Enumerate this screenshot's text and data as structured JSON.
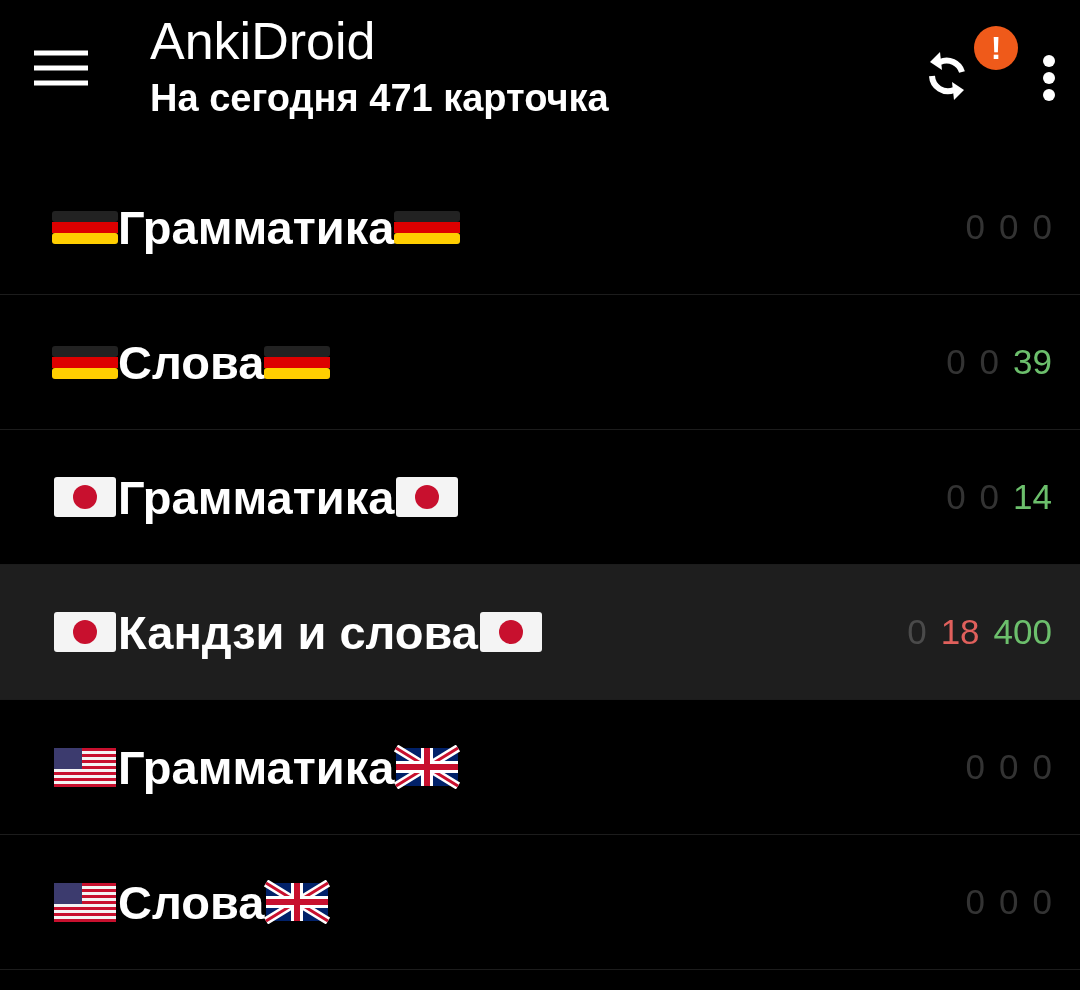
{
  "app_bar": {
    "title": "AnkiDroid",
    "subtitle": "На сегодня 471 карточка",
    "sync_badge": "!"
  },
  "decks": [
    {
      "name": "Грамматика",
      "lead_flag": {
        "kind": "de"
      },
      "trail_flag": {
        "kind": "de"
      },
      "selected": false,
      "counts": [
        {
          "text": "0",
          "color": "#333333"
        },
        {
          "text": "0",
          "color": "#333333"
        },
        {
          "text": "0",
          "color": "#333333"
        }
      ]
    },
    {
      "name": "Слова",
      "lead_flag": {
        "kind": "de"
      },
      "trail_flag": {
        "kind": "de"
      },
      "selected": false,
      "counts": [
        {
          "text": "0",
          "color": "#333333"
        },
        {
          "text": "0",
          "color": "#333333"
        },
        {
          "text": "39",
          "color": "#6cbf6c"
        }
      ]
    },
    {
      "name": "Грамматика",
      "lead_flag": {
        "kind": "jp"
      },
      "trail_flag": {
        "kind": "jp"
      },
      "selected": false,
      "counts": [
        {
          "text": "0",
          "color": "#333333"
        },
        {
          "text": "0",
          "color": "#333333"
        },
        {
          "text": "14",
          "color": "#6cbf6c"
        }
      ]
    },
    {
      "name": "Кандзи и слова",
      "lead_flag": {
        "kind": "jp"
      },
      "trail_flag": {
        "kind": "jp"
      },
      "selected": true,
      "counts": [
        {
          "text": "0",
          "color": "#4a4a4a"
        },
        {
          "text": "18",
          "color": "#e0605c"
        },
        {
          "text": "400",
          "color": "#6cbf6c"
        }
      ]
    },
    {
      "name": "Грамматика",
      "lead_flag": {
        "kind": "us"
      },
      "trail_flag": {
        "kind": "uk"
      },
      "selected": false,
      "counts": [
        {
          "text": "0",
          "color": "#333333"
        },
        {
          "text": "0",
          "color": "#333333"
        },
        {
          "text": "0",
          "color": "#333333"
        }
      ]
    },
    {
      "name": "Слова",
      "lead_flag": {
        "kind": "us"
      },
      "trail_flag": {
        "kind": "uk"
      },
      "selected": false,
      "counts": [
        {
          "text": "0",
          "color": "#333333"
        },
        {
          "text": "0",
          "color": "#333333"
        },
        {
          "text": "0",
          "color": "#333333"
        }
      ]
    }
  ]
}
